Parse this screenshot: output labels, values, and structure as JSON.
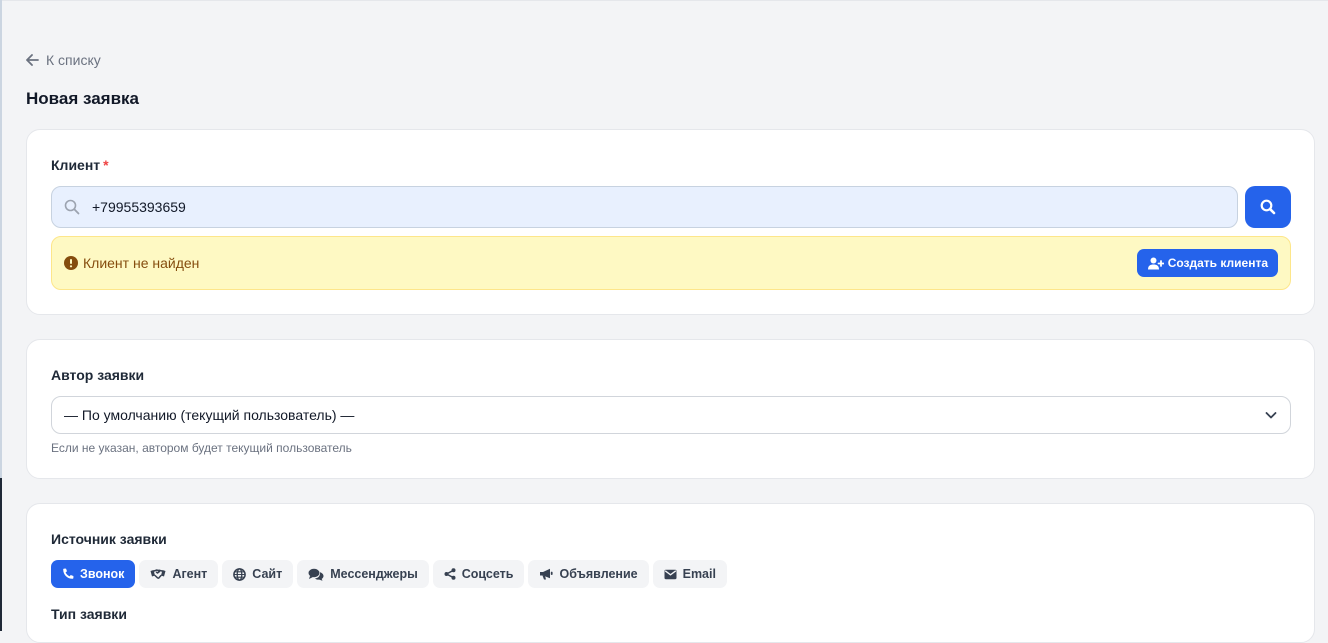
{
  "nav": {
    "back_label": "К списку"
  },
  "page": {
    "title": "Новая заявка"
  },
  "client": {
    "label": "Клиент",
    "required_mark": "*",
    "search_value": "+79955393659",
    "alert_text": "Клиент не найден",
    "create_button_label": "Создать клиента"
  },
  "author": {
    "label": "Автор заявки",
    "selected": "— По умолчанию (текущий пользователь) —",
    "hint": "Если не указан, автором будет текущий пользователь"
  },
  "source": {
    "label": "Источник заявки",
    "options": [
      {
        "label": "Звонок",
        "icon": "phone-icon",
        "active": true
      },
      {
        "label": "Агент",
        "icon": "handshake-icon",
        "active": false
      },
      {
        "label": "Сайт",
        "icon": "globe-icon",
        "active": false
      },
      {
        "label": "Мессенджеры",
        "icon": "chat-icon",
        "active": false
      },
      {
        "label": "Соцсеть",
        "icon": "share-icon",
        "active": false
      },
      {
        "label": "Объявление",
        "icon": "megaphone-icon",
        "active": false
      },
      {
        "label": "Email",
        "icon": "envelope-icon",
        "active": false
      }
    ]
  },
  "type": {
    "label": "Тип заявки"
  },
  "colors": {
    "primary": "#2563eb",
    "background": "#f3f4f6",
    "alert_bg": "#fef9c3",
    "alert_text": "#854d0e",
    "search_bg": "#e8f0fe",
    "required": "#ef4444"
  }
}
